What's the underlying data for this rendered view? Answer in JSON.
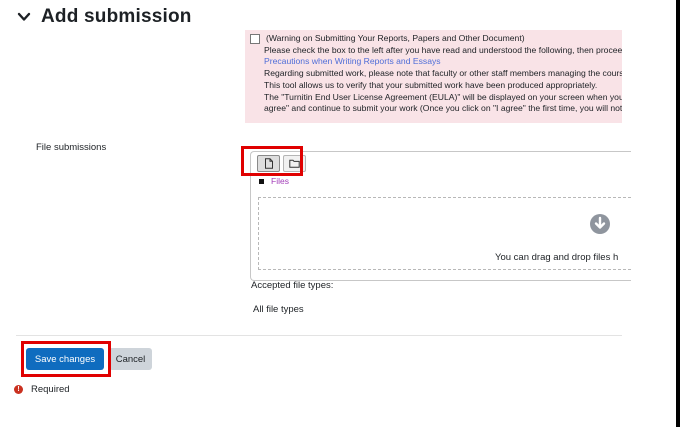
{
  "header": {
    "title": "Add submission"
  },
  "notice": {
    "lines": [
      "(Warning on Submitting Your Reports, Papers and Other Document)",
      "Please check the box to the left after you have read and understood the following, then proceed t",
      "Precautions when Writing Reports and Essays",
      "Regarding submitted work, please note that faculty or other staff members managing the course",
      "This tool allows us to verify that your submitted work have been produced appropriately.",
      "The \"Turnitin End User License Agreement (EULA)\" will be displayed on your screen when you atte",
      "agree\" and continue to submit your work (Once you click on \"I agree\" the first time, you will not b"
    ]
  },
  "file_submissions": {
    "label": "File submissions",
    "breadcrumb": "Files",
    "drop_text": "You can drag and drop files h",
    "accepted_label": "Accepted file types:",
    "accepted_value": "All file types"
  },
  "buttons": {
    "save": "Save changes",
    "cancel": "Cancel"
  },
  "required_label": "Required",
  "colors": {
    "primary": "#0f6cbf",
    "highlight": "#e00000",
    "notice_bg": "#f9e3e7",
    "link": "#4f6ed8",
    "required": "#ca3120"
  },
  "icons": [
    "chevron-down-icon",
    "file-icon",
    "folder-icon",
    "download-circle-icon",
    "exclamation-circle-icon"
  ]
}
